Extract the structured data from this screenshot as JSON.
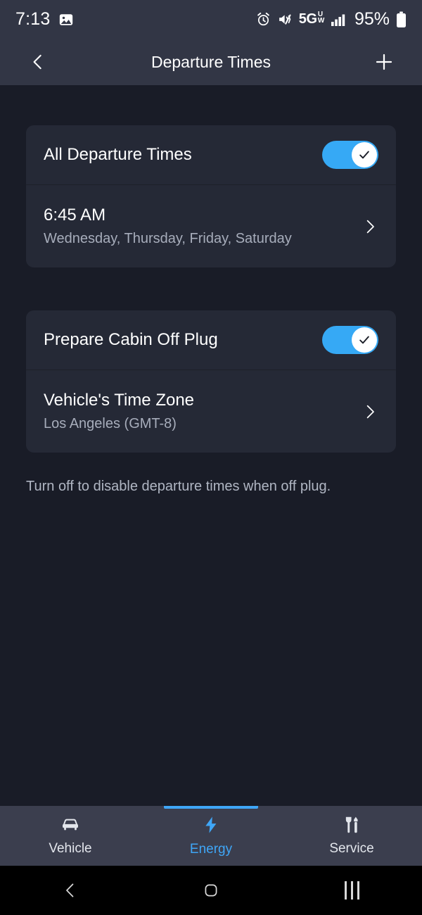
{
  "status_bar": {
    "time": "7:13",
    "gallery_icon": "image-icon",
    "alarm_icon": "alarm-clock-icon",
    "mute_icon": "mute-vibrate-icon",
    "network_type": "5G",
    "network_band_line1": "U",
    "network_band_line2": "W",
    "signal_icon": "signal-bars-icon",
    "battery_percent": "95%",
    "battery_icon": "battery-full-icon"
  },
  "header": {
    "back_icon": "chevron-left-icon",
    "title": "Departure Times",
    "add_icon": "plus-icon"
  },
  "cards": {
    "departure": {
      "toggle_row": {
        "label": "All Departure Times",
        "toggle_on": true,
        "toggle_icon": "check-icon"
      },
      "time_row": {
        "title": "6:45 AM",
        "subtitle": "Wednesday, Thursday, Friday, Saturday",
        "chevron_icon": "chevron-right-icon"
      }
    },
    "settings": {
      "toggle_row": {
        "label": "Prepare Cabin Off Plug",
        "toggle_on": true,
        "toggle_icon": "check-icon"
      },
      "timezone_row": {
        "title": "Vehicle's Time Zone",
        "subtitle": "Los Angeles (GMT-8)",
        "chevron_icon": "chevron-right-icon"
      }
    }
  },
  "footer_note": "Turn off to disable departure times when off plug.",
  "tab_bar": {
    "tabs": [
      {
        "label": "Vehicle",
        "icon": "car-icon",
        "active": false
      },
      {
        "label": "Energy",
        "icon": "lightning-bolt-icon",
        "active": true
      },
      {
        "label": "Service",
        "icon": "wrench-screwdriver-icon",
        "active": false
      }
    ]
  },
  "android_nav": {
    "back_icon": "android-back-icon",
    "home_icon": "android-home-icon",
    "recents_icon": "android-recents-icon"
  },
  "colors": {
    "accent": "#3fa6f7",
    "toggle_on": "#36a9f5",
    "page_bg": "#191c27",
    "card_bg": "#252936",
    "bar_bg": "#323645",
    "tabbar_bg": "#3b3e4e"
  }
}
